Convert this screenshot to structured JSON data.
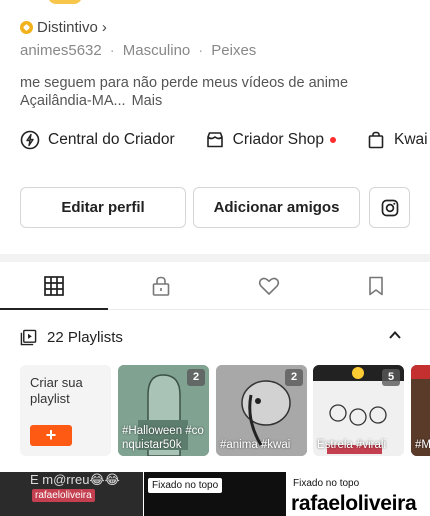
{
  "profile": {
    "badge_label": "Distintivo",
    "badge_chevron": "›",
    "username": "animes5632",
    "gender": "Masculino",
    "sign": "Peixes",
    "separator": "·",
    "bio_line1": "me seguem para não perde meus vídeos de anime",
    "bio_line2": "Açailândia-MA...",
    "bio_more": "Mais"
  },
  "tools": [
    {
      "label": "Central do Criador",
      "icon": "lightning-icon"
    },
    {
      "label": "Criador Shop",
      "icon": "shop-icon",
      "dot": true
    },
    {
      "label": "Kwai Sh",
      "icon": "bag-icon"
    }
  ],
  "buttons": {
    "edit": "Editar perfil",
    "add": "Adicionar amigos",
    "instagram_icon": "instagram-icon"
  },
  "tabs": [
    {
      "name": "grid",
      "icon": "grid-icon",
      "active": true
    },
    {
      "name": "private",
      "icon": "lock-icon"
    },
    {
      "name": "liked",
      "icon": "heart-icon"
    },
    {
      "name": "saved",
      "icon": "bookmark-icon"
    }
  ],
  "playlists": {
    "title": "22 Playlists",
    "create_label": "Criar sua playlist",
    "create_plus": "+",
    "items": [
      {
        "count": "2",
        "caption": "#Halloween #conquistar50k"
      },
      {
        "count": "2",
        "caption": "#anima #kwai"
      },
      {
        "count": "5",
        "caption": "Estrela #virali"
      },
      {
        "count": "",
        "caption": "#M #g"
      }
    ]
  },
  "videos": {
    "v1_text": "E m@rreu😂😂",
    "v1_tag": "rafaeloliveira",
    "v2_pin": "Fixado no topo",
    "v3_pin": "Fixado no topo",
    "v3_big": "rafaeloliveira"
  },
  "colors": {
    "accent": "#ff5a14",
    "badge": "#f2b21c",
    "notif_dot": "#ff2d2d"
  }
}
